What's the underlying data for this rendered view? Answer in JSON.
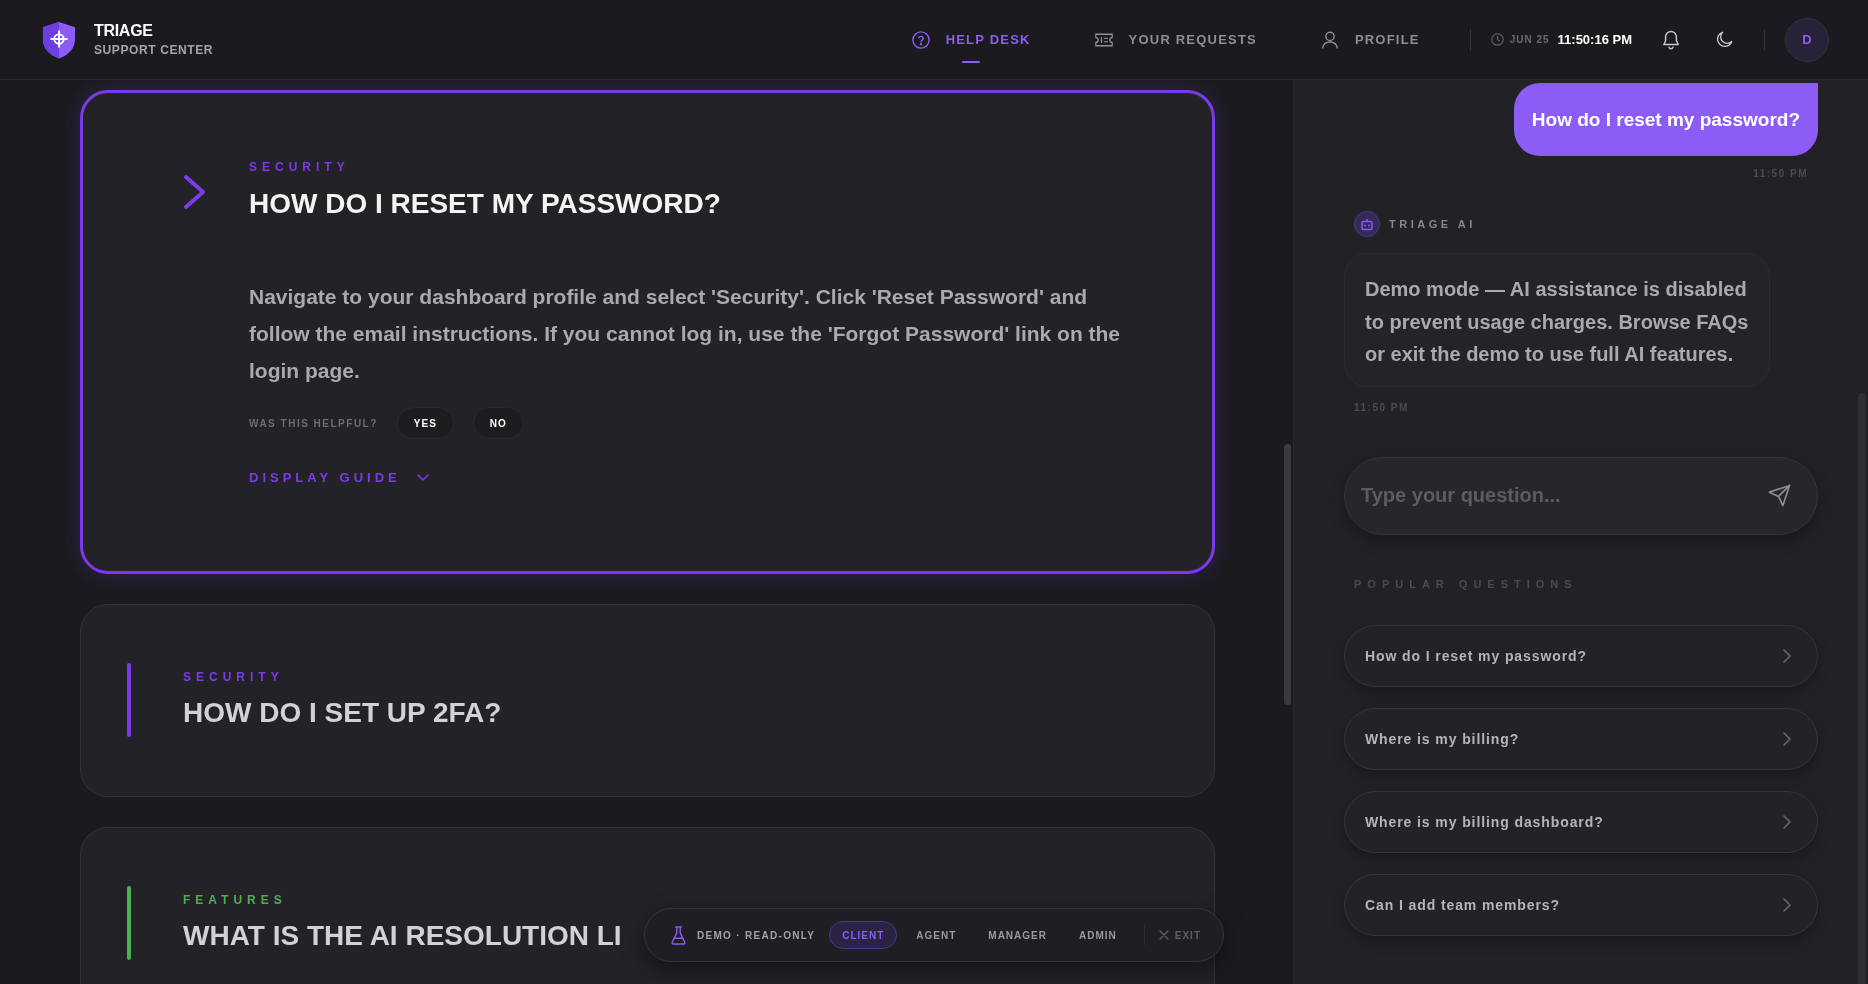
{
  "header": {
    "brand": {
      "name": "TRIAGE",
      "tagline": "SUPPORT CENTER"
    },
    "nav": [
      {
        "label": "HELP DESK",
        "kind": "help",
        "selected": true
      },
      {
        "label": "YOUR REQUESTS",
        "kind": "ticket",
        "selected": false
      },
      {
        "label": "PROFILE",
        "kind": "user",
        "selected": false
      }
    ],
    "date": "JUN 25",
    "time": "11:50:16 PM",
    "avatar": "D"
  },
  "faqs": [
    {
      "category": "SECURITY",
      "color": "#7c3aed",
      "title": "HOW DO I RESET MY PASSWORD?",
      "expanded": true,
      "answer": "Navigate to your dashboard profile and select 'Security'. Click 'Reset Password' and follow the email instructions. If you cannot log in, use the 'Forgot Password' link on the login page.",
      "helpful_prompt": "WAS THIS HELPFUL?",
      "votes": [
        "YES",
        "NO"
      ],
      "guide_link": "DISPLAY GUIDE"
    },
    {
      "category": "SECURITY",
      "color": "#7c3aed",
      "title": "HOW DO I SET UP 2FA?",
      "expanded": false
    },
    {
      "category": "FEATURES",
      "color": "#4caf50",
      "title": "WHAT IS THE AI RESOLUTION LI",
      "expanded": false
    }
  ],
  "chat": {
    "messages": [
      {
        "kind": "user",
        "text": "How do I reset my password?",
        "time": "11:50 PM"
      },
      {
        "kind": "bot",
        "sender": "TRIAGE AI",
        "text": "Demo mode — AI assistance is disabled to prevent usage charges. Browse FAQs or exit the demo to use full AI features.",
        "time": "11:50 PM"
      }
    ],
    "input": {
      "placeholder": "Type your question..."
    },
    "popular_title": "POPULAR QUESTIONS",
    "popular": [
      "How do I reset my password?",
      "Where is my billing?",
      "Where is my billing dashboard?",
      "Can I add team members?"
    ]
  },
  "demo_bar": {
    "label": "DEMO · READ-ONLY",
    "roles": [
      {
        "label": "CLIENT",
        "selected": true
      },
      {
        "label": "AGENT",
        "selected": false
      },
      {
        "label": "MANAGER",
        "selected": false
      },
      {
        "label": "ADMIN",
        "selected": false
      }
    ],
    "exit": "EXIT"
  }
}
